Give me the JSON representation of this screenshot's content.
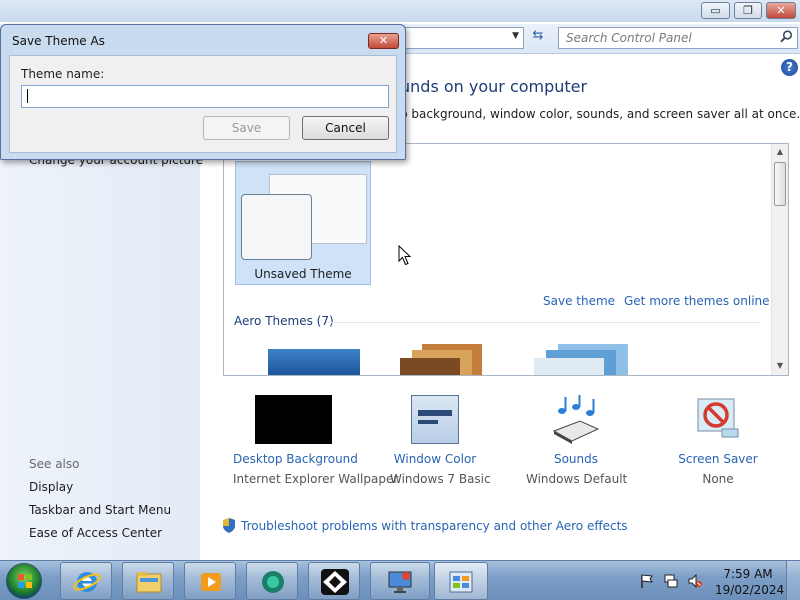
{
  "control_panel": {
    "search_placeholder": "Search Control Panel",
    "left_pane": {
      "links": [
        "Change your account picture"
      ],
      "see_also_heading": "See also",
      "see_also": [
        "Display",
        "Taskbar and Start Menu",
        "Ease of Access Center"
      ]
    },
    "heading": "unds on your computer",
    "description": "p background, window color, sounds, and screen saver all at once.",
    "theme_box": {
      "unsaved_label": "Unsaved Theme",
      "save_theme_link": "Save theme",
      "get_more_link": "Get more themes online",
      "aero_heading": "Aero Themes (7)"
    },
    "settings": [
      {
        "name": "Desktop Background",
        "value": "Internet Explorer Wallpaper"
      },
      {
        "name": "Window Color",
        "value": "Windows 7 Basic"
      },
      {
        "name": "Sounds",
        "value": "Windows Default"
      },
      {
        "name": "Screen Saver",
        "value": "None"
      }
    ],
    "troubleshoot_link": "Troubleshoot problems with transparency and other Aero effects",
    "window_buttons": {
      "minimize": "▭",
      "maximize": "❐",
      "close": "✕"
    }
  },
  "dialog": {
    "title": "Save Theme As",
    "label": "Theme name:",
    "input_value": "",
    "save_button": "Save",
    "cancel_button": "Cancel",
    "close_glyph": "✕"
  },
  "taskbar": {
    "time": "7:59 AM",
    "date": "19/02/2024",
    "pinned": [
      "internet-explorer-icon",
      "file-explorer-icon",
      "media-player-icon",
      "app-icon",
      "app-icon-2",
      "display-settings-icon",
      "control-panel-icon"
    ]
  },
  "colors": {
    "link": "#2864b4",
    "heading": "#1e3d78",
    "dialog_frame": "#c9dbef",
    "taskbar": "#7d9fc7"
  }
}
